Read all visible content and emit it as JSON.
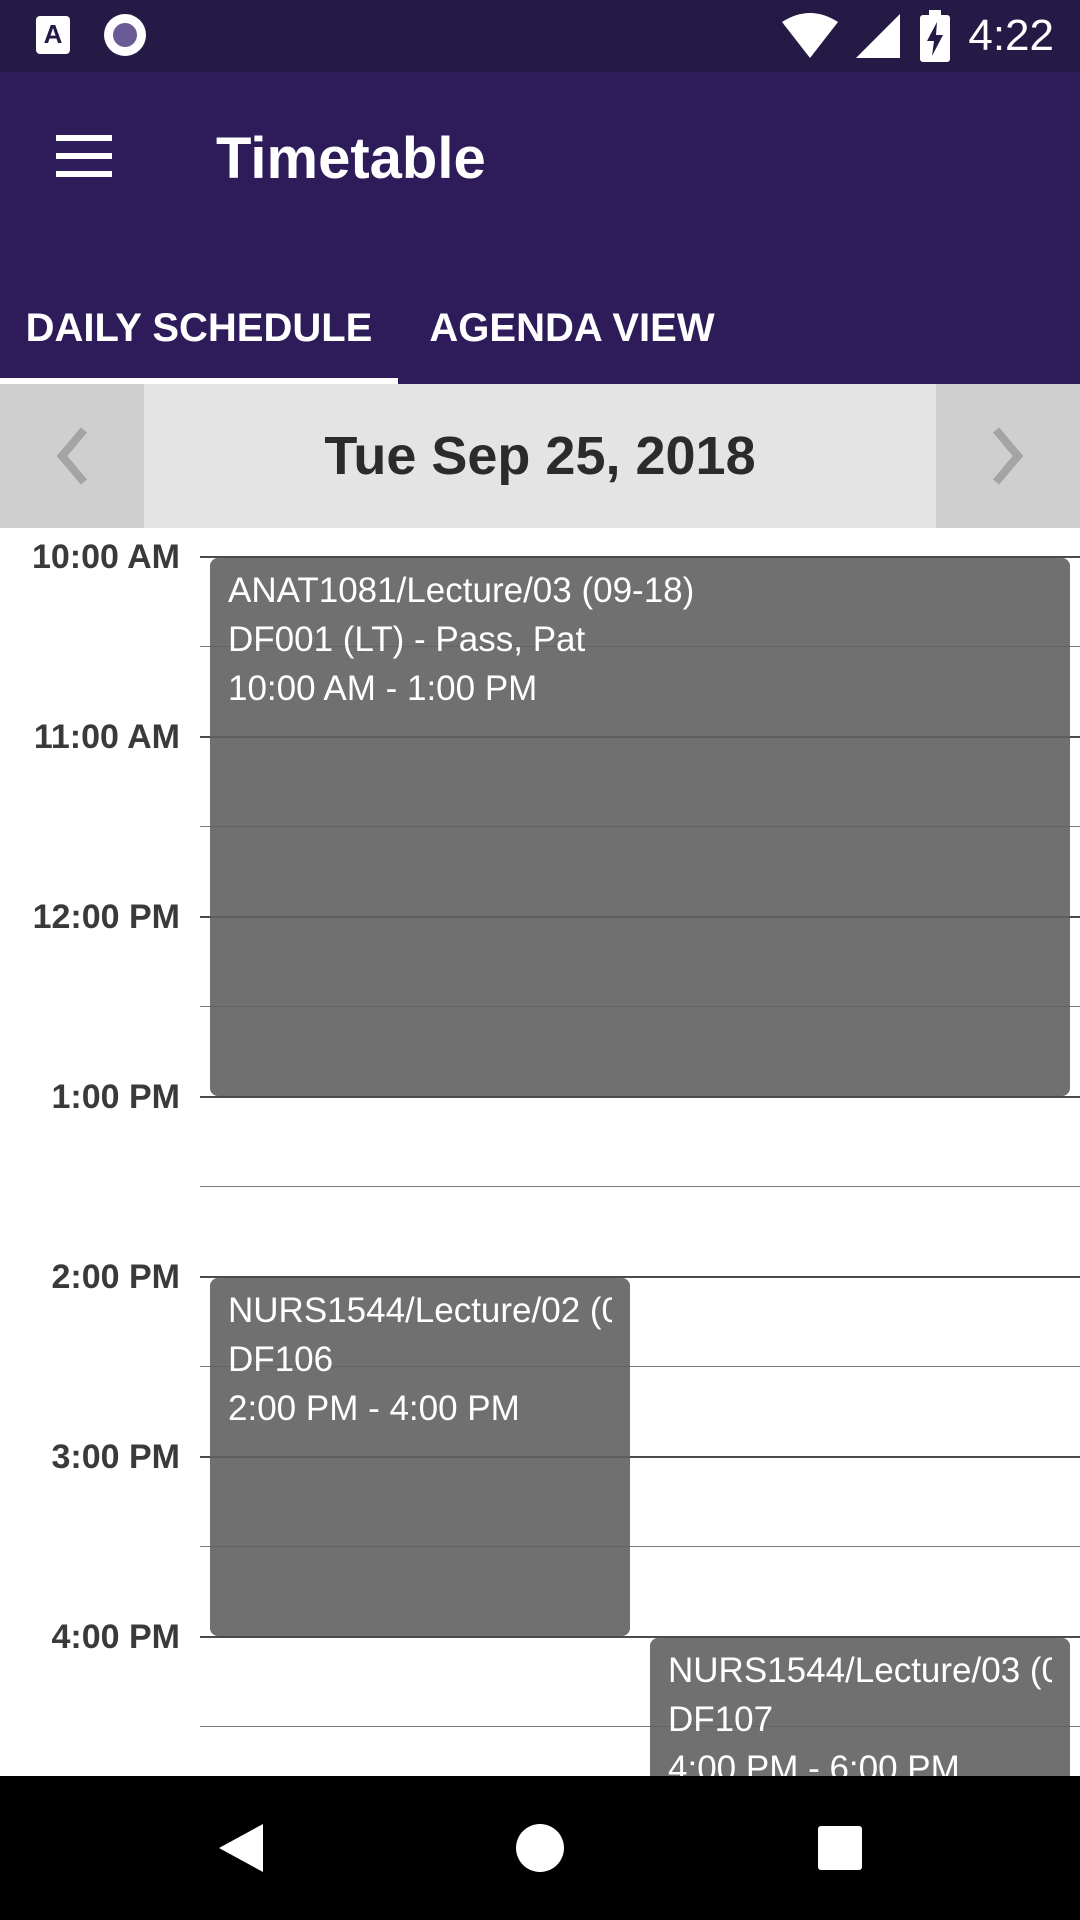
{
  "status_bar": {
    "time": "4:22",
    "icons": [
      "a-notification-icon",
      "circle-app-icon",
      "wifi-icon",
      "signal-icon",
      "battery-charging-icon"
    ]
  },
  "app_bar": {
    "title": "Timetable",
    "menu_icon": "hamburger-menu-icon",
    "colors": {
      "status_bar": "#251a45",
      "app_bar": "#2e1c5a"
    }
  },
  "tabs": [
    {
      "label": "DAILY SCHEDULE",
      "selected": true
    },
    {
      "label": "AGENDA VIEW",
      "selected": false
    }
  ],
  "date_nav": {
    "date": "Tue Sep 25, 2018",
    "prev_icon": "chevron-left-icon",
    "next_icon": "chevron-right-icon"
  },
  "schedule": {
    "time_labels": [
      "10:00 AM",
      "11:00 AM",
      "12:00 PM",
      "1:00 PM",
      "2:00 PM",
      "3:00 PM",
      "4:00 PM"
    ],
    "events": [
      {
        "title": "ANAT1081/Lecture/03 (09-18)",
        "room": "DF001 (LT) - Pass, Pat",
        "time": "10:00 AM - 1:00 PM"
      },
      {
        "title": "NURS1544/Lecture/02 (0",
        "room": "DF106",
        "time": "2:00 PM - 4:00 PM"
      },
      {
        "title": "NURS1544/Lecture/03 (0",
        "room": "DF107",
        "time": "4:00 PM - 6:00 PM"
      }
    ],
    "event_color": "#6e6e6e"
  },
  "nav_bar": {
    "icons": [
      "back-icon",
      "home-icon",
      "recents-icon"
    ]
  }
}
